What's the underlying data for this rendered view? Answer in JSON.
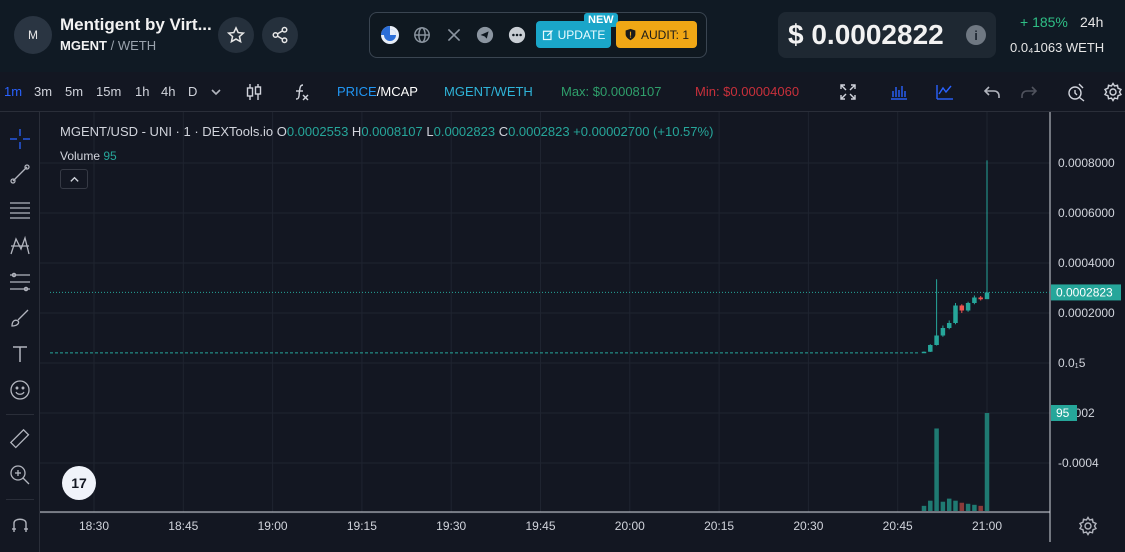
{
  "header": {
    "avatar_letter": "M",
    "token_name": "Mentigent by Virt...",
    "base_symbol": "MGENT",
    "separator": "/",
    "quote_symbol": "WETH",
    "update_label": "UPDATE",
    "new_badge": "NEW",
    "audit_label": "AUDIT: 1",
    "price": "$ 0.0002822",
    "change": "+ 185%",
    "change_period": "24h",
    "weth_price": "0.0₄1063  WETH"
  },
  "toolbar": {
    "timeframes": [
      "1m",
      "3m",
      "5m",
      "15m",
      "1h",
      "4h",
      "D"
    ],
    "active_timeframe": "1m",
    "price_label": "PRICE",
    "price_sep": "/",
    "mcap_label": "MCAP",
    "pair_label": "MGENT/WETH",
    "max_label": "Max: $0.0008107",
    "min_label": "Min: $0.00004060"
  },
  "legend": {
    "symbol": "MGENT/USD - UNI · 1 · DEXTools.io",
    "o_label": "O",
    "o_value": "0.0002553",
    "h_label": "H",
    "h_value": "0.0008107",
    "l_label": "L",
    "l_value": "0.0002823",
    "c_label": "C",
    "c_value": "0.0002823",
    "change": "+0.00002700 (+10.57%)",
    "volume_label": "Volume",
    "volume_value": "95"
  },
  "tv_logo": "17",
  "colors": {
    "up": "#26a69a",
    "down": "#ef5350",
    "accent": "#2962ff",
    "background": "#131722"
  },
  "chart_data": {
    "type": "candlestick",
    "x_ticks": [
      "18:30",
      "18:45",
      "19:00",
      "19:15",
      "19:30",
      "19:45",
      "20:00",
      "20:15",
      "20:30",
      "20:45",
      "21:00"
    ],
    "price_ticks": [
      "0.0008000",
      "0.0006000",
      "0.0004000",
      "0.0002000",
      "0.0₁5"
    ],
    "volume_ticks": [
      "0.0002",
      "-0.0004"
    ],
    "ylim": [
      0,
      0.00092
    ],
    "current_price_label": "0.0002823",
    "current_volume_label": "95",
    "baseline_price": 4.06e-05,
    "candles": [
      {
        "t": "20:48",
        "o": 4.06e-05,
        "h": 4.6e-05,
        "l": 4e-05,
        "c": 4.5e-05
      },
      {
        "t": "20:49",
        "o": 4.5e-05,
        "h": 7.5e-05,
        "l": 4.4e-05,
        "c": 7.2e-05
      },
      {
        "t": "20:50",
        "o": 7.2e-05,
        "h": 0.000335,
        "l": 7e-05,
        "c": 0.00011
      },
      {
        "t": "20:51",
        "o": 0.00011,
        "h": 0.00015,
        "l": 0.000105,
        "c": 0.00014
      },
      {
        "t": "20:52",
        "o": 0.00014,
        "h": 0.00017,
        "l": 0.000135,
        "c": 0.00016
      },
      {
        "t": "20:53",
        "o": 0.00016,
        "h": 0.00024,
        "l": 0.000155,
        "c": 0.00023
      },
      {
        "t": "20:54",
        "o": 0.00023,
        "h": 0.000235,
        "l": 0.0002,
        "c": 0.00021
      },
      {
        "t": "20:55",
        "o": 0.00021,
        "h": 0.000245,
        "l": 0.000205,
        "c": 0.00024
      },
      {
        "t": "20:56",
        "o": 0.00024,
        "h": 0.00027,
        "l": 0.000235,
        "c": 0.000262
      },
      {
        "t": "20:57",
        "o": 0.000262,
        "h": 0.000268,
        "l": 0.00025,
        "c": 0.000255
      },
      {
        "t": "20:58",
        "o": 0.0002553,
        "h": 0.0008107,
        "l": 0.0002823,
        "c": 0.0002823
      }
    ],
    "volumes": [
      {
        "t": "20:48",
        "v": 5,
        "up": true
      },
      {
        "t": "20:49",
        "v": 10,
        "up": true
      },
      {
        "t": "20:50",
        "v": 80,
        "up": true
      },
      {
        "t": "20:51",
        "v": 9,
        "up": true
      },
      {
        "t": "20:52",
        "v": 12,
        "up": true
      },
      {
        "t": "20:53",
        "v": 10,
        "up": true
      },
      {
        "t": "20:54",
        "v": 8,
        "up": false
      },
      {
        "t": "20:55",
        "v": 7,
        "up": true
      },
      {
        "t": "20:56",
        "v": 6,
        "up": true
      },
      {
        "t": "20:57",
        "v": 5,
        "up": false
      },
      {
        "t": "20:58",
        "v": 95,
        "up": true
      }
    ]
  }
}
